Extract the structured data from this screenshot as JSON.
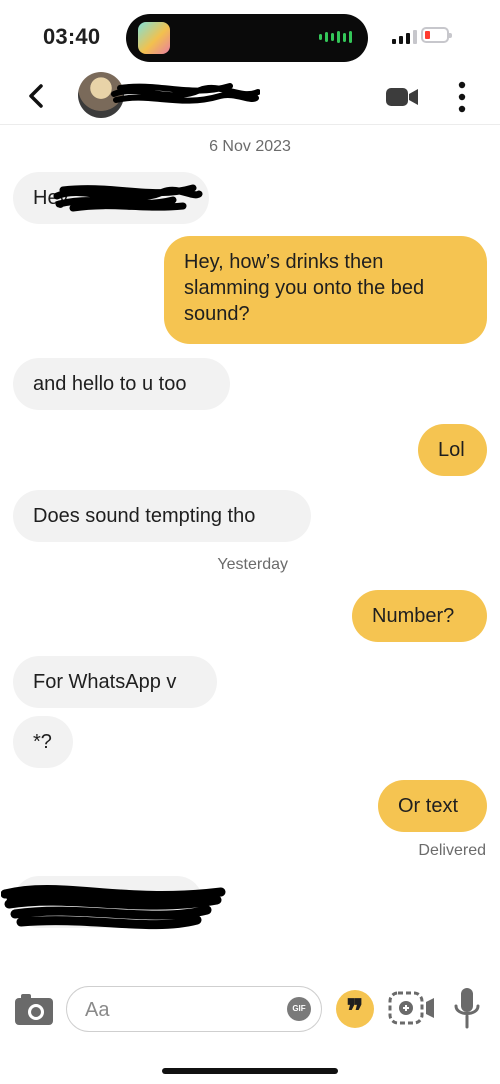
{
  "status_bar": {
    "time": "03:40"
  },
  "header": {
    "date_separator": "6 Nov 2023"
  },
  "messages": [
    {
      "side": "in",
      "text": "Hey"
    },
    {
      "side": "out",
      "text": "Hey, how’s drinks then slamming you onto the bed sound?"
    },
    {
      "side": "in",
      "text": "and hello to u too"
    },
    {
      "side": "out",
      "text": "Lol"
    },
    {
      "side": "in",
      "text": "Does sound tempting tho"
    },
    {
      "side": "out",
      "text": "Number?"
    },
    {
      "side": "in",
      "text": "For WhatsApp v"
    },
    {
      "side": "in",
      "text": "*?"
    },
    {
      "side": "out",
      "text": "Or text"
    }
  ],
  "separators": {
    "yesterday": "Yesterday"
  },
  "receipt": "Delivered",
  "composer": {
    "placeholder": "Aa",
    "gif_label": "GIF",
    "quote_glyph": "❞"
  },
  "colors": {
    "accent": "#f5c451",
    "incoming_bubble": "#f2f2f2"
  },
  "icons": [
    "back-chevron-icon",
    "video-call-icon",
    "more-vertical-icon",
    "camera-icon",
    "gif-icon",
    "quote-icon",
    "video-note-icon",
    "microphone-icon"
  ]
}
